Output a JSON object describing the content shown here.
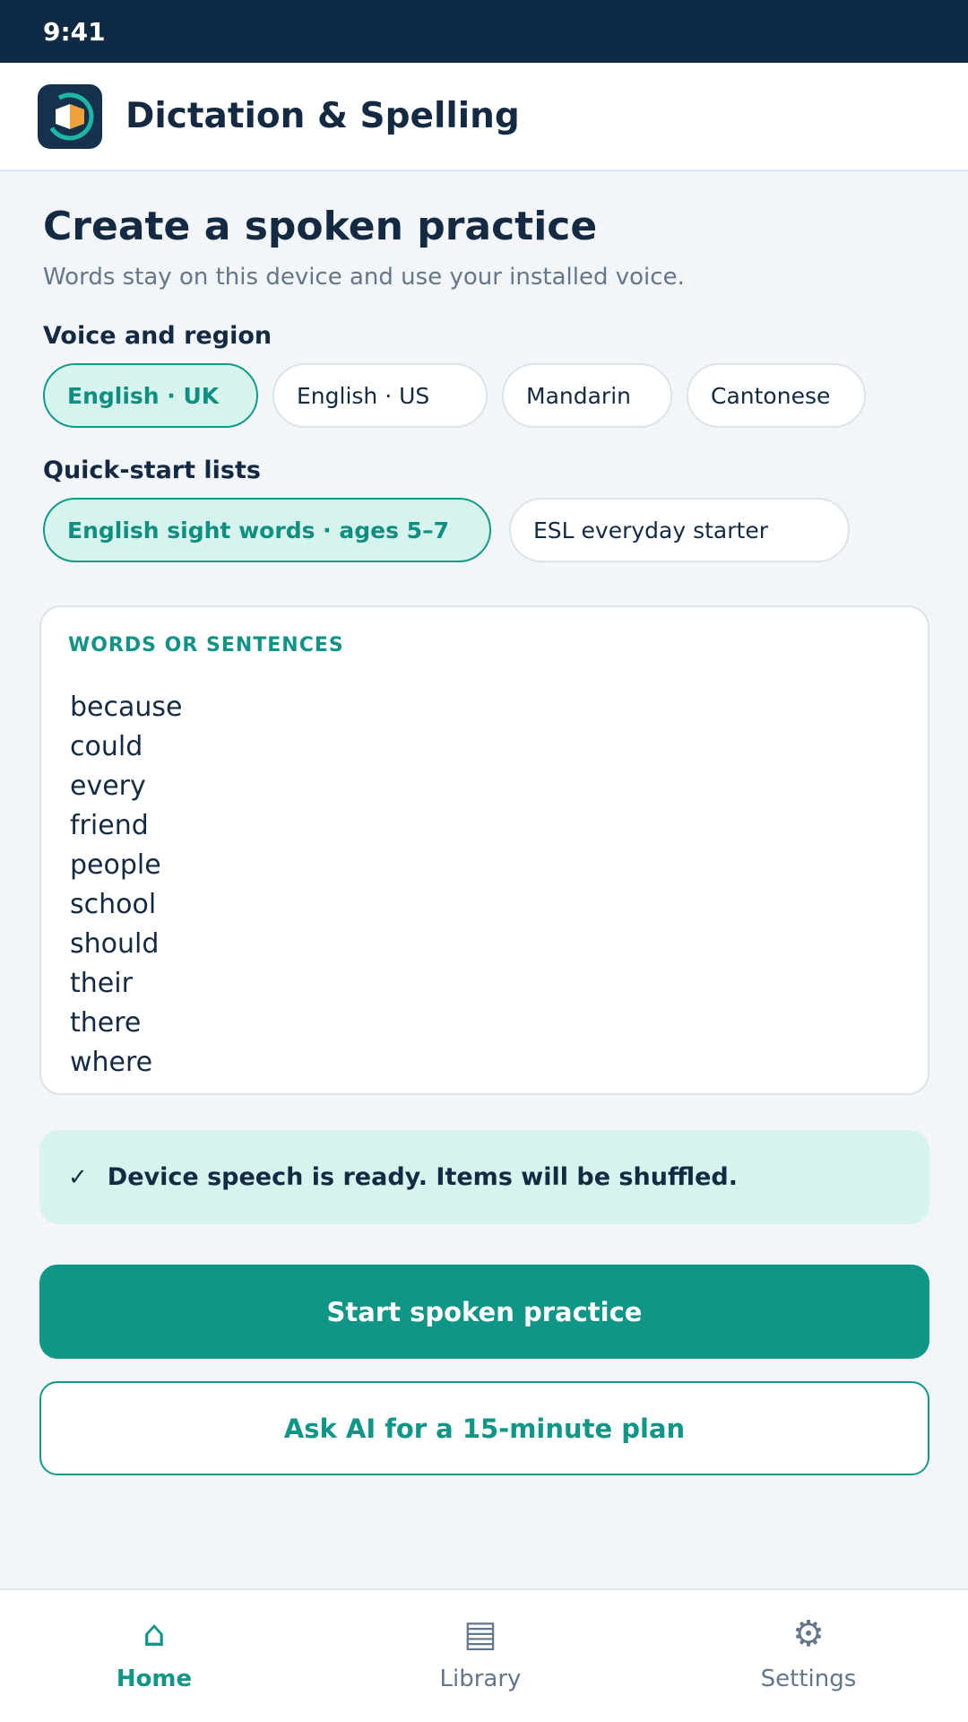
{
  "status_bar": {
    "time": "9:41"
  },
  "header": {
    "title": "Dictation & Spelling"
  },
  "page": {
    "title": "Create a spoken practice",
    "subtitle": "Words stay on this device and use your installed voice."
  },
  "voice": {
    "label": "Voice and region",
    "options": [
      "English · UK",
      "English · US",
      "Mandarin",
      "Cantonese"
    ],
    "selected": "English · UK"
  },
  "quick_start": {
    "label": "Quick-start lists",
    "options": [
      "English sight words · ages 5–7",
      "ESL everyday starter"
    ],
    "selected": "English sight words · ages 5–7"
  },
  "words": {
    "label": "WORDS OR SENTENCES",
    "items": [
      "because",
      "could",
      "every",
      "friend",
      "people",
      "school",
      "should",
      "their",
      "there",
      "where"
    ]
  },
  "status_message": {
    "icon": "check-icon",
    "text": "Device speech is ready. Items will be shuffled."
  },
  "actions": {
    "start_label": "Start spoken practice",
    "ai_plan_label": "Ask AI for a 15-minute plan"
  },
  "nav": {
    "items": [
      {
        "label": "Home",
        "icon": "home-icon"
      },
      {
        "label": "Library",
        "icon": "library-icon"
      },
      {
        "label": "Settings",
        "icon": "gear-icon"
      }
    ],
    "active": "Home"
  },
  "colors": {
    "accent": "#109686",
    "accent_light": "#d7f3ee",
    "header_dark": "#0f2a45",
    "text_primary": "#132a42",
    "text_muted": "#64768a"
  }
}
